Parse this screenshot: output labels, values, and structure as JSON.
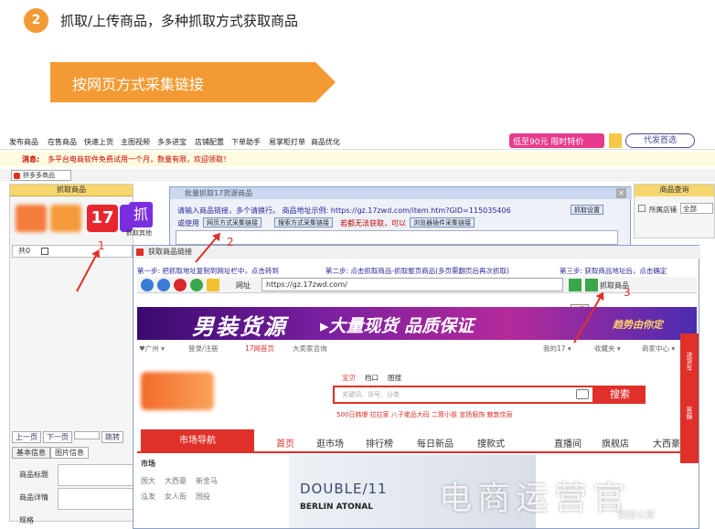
{
  "header": {
    "step_number": "2",
    "step_title": "抓取/上传商品，多种抓取方式获取商品"
  },
  "banner": {
    "label": "按网页方式采集链接"
  },
  "app": {
    "menu": [
      "发布商品",
      "在售商品",
      "快速上货",
      "主图视频",
      "多多进宝",
      "店铺配置",
      "下单助手",
      "易掌柜打单",
      "商品优化"
    ],
    "promo": "低至90元 限时特价",
    "agent_button": "代发首选",
    "message_label": "消息:",
    "message_text": "多平台电商软件免费试用一个月，数量有限，欢迎领取！",
    "store_tab": "拼多多商品",
    "left_panel": {
      "title": "抓取商品",
      "logo_17": "17",
      "logo_grab": "抓",
      "grab_other": "抓取其他",
      "grid_count": "共0",
      "pager": [
        "上一页",
        "下一页",
        "跳转"
      ],
      "info_tabs": [
        "基本信息",
        "图片信息"
      ],
      "fields": [
        "商品标题",
        "商品详情",
        "规格"
      ]
    },
    "right_panel": {
      "title": "商品查询",
      "store_label": "所属店铺",
      "store_value": "全部"
    }
  },
  "dialog1": {
    "title": "批量抓取17货源商品",
    "line1": "请输入商品链接，多个请换行。 商品地址示例: https://gz.17zwd.com/item.htm?GID=115035406",
    "settings_btn": "抓取设置",
    "line2_prefix": "或使用",
    "btn_web": "网页方式采集链接",
    "btn_search": "搜索方式采集链接",
    "line2_mid": "若都无法获取，可以",
    "btn_plugin": "浏览器插件采集链接"
  },
  "dialog2": {
    "title": "获取商品链接",
    "step1": "第一步: 把抓取地址复制到网址栏中，点击转到",
    "step2": "第二步: 点击抓取商品-抓取整页商品(多页需翻页后再次抓取)",
    "step3": "第三步: 获取商品地址后，点击确定",
    "url_label": "网址",
    "url_value": "https://gz.17zwd.com/",
    "go_tooltip": "转到",
    "grab_btn": "抓取商品"
  },
  "website": {
    "banner_1": "男装货源",
    "banner_2": "▸大量现货 品质保证",
    "banner_3": "趋势由你定",
    "topbar": [
      "♥广州 ▾",
      "登录/注册",
      "17网首页",
      "大卖家咨询",
      "我的17 ▾",
      "收藏夹 ▾",
      "商家中心 ▾"
    ],
    "search_tabs": [
      "宝贝",
      "档口",
      "图搜"
    ],
    "search_placeholder": "关键词、货号、分类",
    "search_btn": "搜索",
    "hot_words": "500日韩爆  拉拉家  八子佬品大码  二筒小姐  宣扬服饰  魅敦佳丽",
    "cat_main": "市场导航",
    "cat_items": [
      "首页",
      "逛市场",
      "排行榜",
      "每日新品",
      "搜款式",
      "直播间",
      "旗舰店",
      "大西豪"
    ],
    "market_title": "市场",
    "market_rows": [
      [
        "国大",
        "大西豪",
        "新金马"
      ],
      [
        "泓发",
        "女人街",
        "国投"
      ]
    ],
    "promo_t1": "DOUBLE/11",
    "promo_t2": "BERLIN ATONAL",
    "sidebar": [
      "进货车",
      "客服"
    ]
  },
  "annotations": {
    "n1": "1",
    "n2": "2",
    "n3": "3"
  },
  "watermark": {
    "main": "电商运营官",
    "sub": "回饭公寓"
  }
}
